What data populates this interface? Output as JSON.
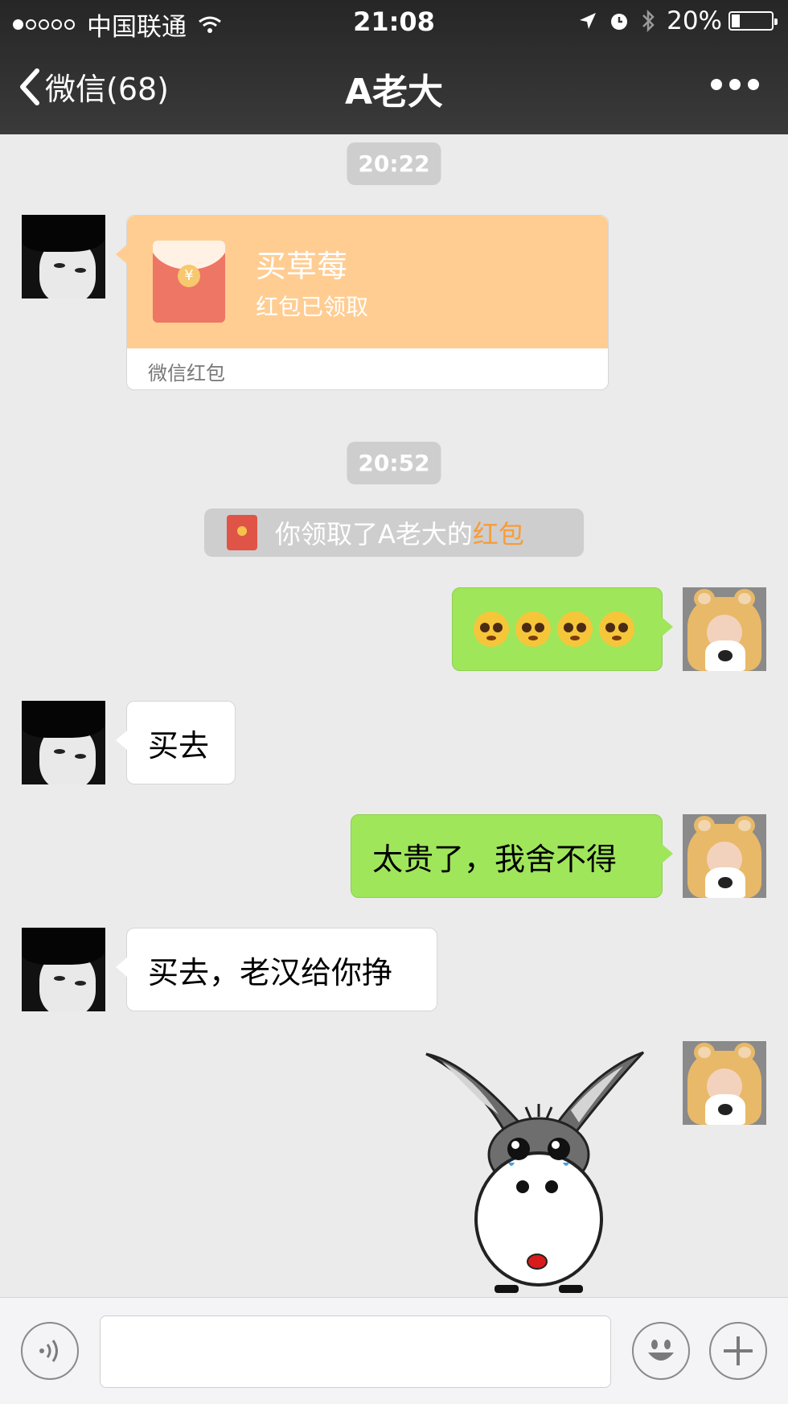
{
  "status_bar": {
    "signal_dots": 5,
    "signal_filled": 1,
    "carrier": "中国联通",
    "time": "21:08",
    "battery_text": "20%",
    "battery_level": 0.2
  },
  "nav": {
    "back_label": "微信(68)",
    "title": "A老大",
    "more_icon": "more-dots-icon"
  },
  "messages": {
    "time1": "20:22",
    "red_packet": {
      "title": "买草莓",
      "status": "红包已领取",
      "footer": "微信红包",
      "coin": "¥"
    },
    "time2": "20:52",
    "system_notice": {
      "prefix": "你领取了A老大的",
      "highlight": "红包"
    },
    "emoji_count": 4,
    "msg1": "买去",
    "msg2": "太贵了，我舍不得",
    "msg3": "买去，老汉给你挣"
  },
  "input_bar": {
    "voice_icon": "voice-icon",
    "emoji_icon": "smiley-icon",
    "plus_icon": "plus-icon",
    "input_value": ""
  },
  "colors": {
    "header_bg": "#2f2f2f",
    "chat_bg": "#ebebeb",
    "green_bubble": "#9fe65b",
    "red_packet": "#ffcd92",
    "highlight": "#f79c3a"
  }
}
